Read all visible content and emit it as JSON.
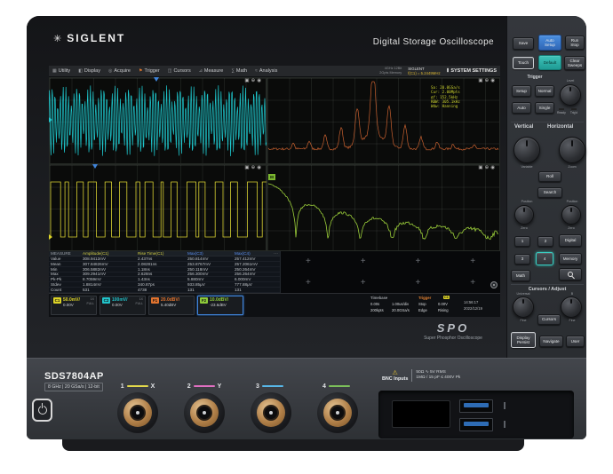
{
  "device": {
    "brand": "SIGLENT",
    "brand_icon": "✳",
    "screen_title": "Digital Storage Oscilloscope",
    "model": "SDS7804AP",
    "specs": "8 GHz | 20 GSa/s | 12-bit",
    "spo": "SPO",
    "spo_subtitle": "Super Phosphor Oscilloscope"
  },
  "menu": {
    "items": [
      {
        "label": "Utility",
        "icon": "▦"
      },
      {
        "label": "Display",
        "icon": "◧"
      },
      {
        "label": "Acquire",
        "icon": "◎"
      },
      {
        "label": "Trigger",
        "icon": "⚑"
      },
      {
        "label": "Cursors",
        "icon": "◫"
      },
      {
        "label": "Measure",
        "icon": "⊿"
      },
      {
        "label": "Math",
        "icon": "∑"
      },
      {
        "label": "Analysis",
        "icon": "≈"
      }
    ]
  },
  "status_strip": {
    "memory_line1": "4GHz 12Bit",
    "memory_line2": "2Gpts Memory",
    "brand": "SIGLENT",
    "counter": "f(C1) = 5.2449MHz",
    "settings_icon": "Ⅱ",
    "settings_label": "SYSTEM SETTINGS"
  },
  "quadrant_icons": {
    "snapshot": "▣",
    "crosshair": "⊕",
    "record": "◉"
  },
  "fft_readout": {
    "lines": [
      "Sa: 20.0GSa/s",
      "Cur: 2.00Mpts",
      "Δf: 152.5kHz",
      "RBW: 305.1kHz",
      "Wdw: Hanning"
    ]
  },
  "marker_m": "M",
  "plus_icon": "+",
  "measure_table": {
    "headers": [
      "MEASURE",
      "Amplitude(C1)",
      "Rise Time(C1)",
      "Max(C3)",
      "Max(C4)"
    ],
    "header_colors": [
      "#9aa0a8",
      "#d3cf45",
      "#d3cf45",
      "#5b8ff0",
      "#5b8ff0"
    ],
    "more_icon": "⋯",
    "rows": [
      {
        "name": "Value",
        "cells": [
          "308.9412mV",
          "2.437ns",
          "250.814mV",
          "257.412mV"
        ]
      },
      {
        "name": "Mean",
        "cells": [
          "307.84826mV",
          "2.08281ns",
          "253.8767mV",
          "257.2061mV"
        ]
      },
      {
        "name": "Min",
        "cells": [
          "306.5882mV",
          "1.18ns",
          "250.118mV",
          "250.264mV"
        ]
      },
      {
        "name": "Max",
        "cells": [
          "309.2941mV",
          "2.628ns",
          "256.300mV",
          "256.264mV"
        ]
      },
      {
        "name": "Pk-Pk",
        "cells": [
          "8.7059mV",
          "1.43ns",
          "5.880mV",
          "6.000mV"
        ]
      },
      {
        "name": "Stdev",
        "cells": [
          "1.8814mV",
          "340.87ps",
          "933.85μV",
          "777.88μV"
        ]
      },
      {
        "name": "Count",
        "cells": [
          "531",
          "4738",
          "131",
          "131"
        ]
      }
    ]
  },
  "status_bar": {
    "channels": [
      {
        "id": "C1",
        "color": "#ddd428",
        "probe": "1X",
        "coupling": "FULL",
        "scale": "50.0mV/",
        "offset": "0.00V",
        "selected": false
      },
      {
        "id": "C2",
        "color": "#22c3ca",
        "probe": "1X",
        "coupling": "FULL",
        "scale": "100mV/",
        "offset": "0.00V",
        "selected": false
      },
      {
        "id": "F1",
        "color": "#e0732f",
        "probe": "",
        "coupling": "",
        "scale": "20.0dBV/",
        "offset": "5.40dBV",
        "selected": false
      },
      {
        "id": "F2",
        "color": "#8ecb3a",
        "probe": "",
        "coupling": "",
        "scale": "10.0dBV/",
        "offset": "-23.6dBV",
        "selected": true
      }
    ],
    "timebase": {
      "label": "Timebase",
      "delay": "0.00s",
      "scale": "1.00us/div",
      "points": "200kpts",
      "rate": "20.0GSa/s"
    },
    "trigger": {
      "label": "Trigger",
      "source": "C1",
      "status": "Stop",
      "level": "0.00V",
      "type": "Edge",
      "slope": "Rising"
    },
    "clock": {
      "time": "14:56:17",
      "date": "2022/12/19"
    }
  },
  "control_panel": {
    "save": "Save",
    "auto_setup": "Auto Setup",
    "run_stop": "Run Stop",
    "touch": "Touch",
    "default": "Default",
    "clear_sweeps": "Clear Sweeps",
    "trigger_section": "Trigger",
    "setup": "Setup",
    "normal": "Normal",
    "auto": "Auto",
    "single": "Single",
    "level": "Level",
    "ready": "Ready",
    "trigd": "Trig'd",
    "vertical": "Vertical",
    "horizontal": "Horizontal",
    "variable": "Variable",
    "zoom": "Zoom",
    "roll": "Roll",
    "search": "Search",
    "position": "Position",
    "zero": "Zero",
    "ch1": "1",
    "ch2": "2",
    "ch3": "3",
    "ch4": "4",
    "digital": "Digital",
    "memory": "Memory",
    "math": "Math",
    "cursors_adjust": "Cursors / Adjust",
    "universal": "Universal",
    "knob_b": "B",
    "fine": "Fine",
    "cursors": "Cursors",
    "display_persist": "Display Persist",
    "navigate": "Navigate",
    "user": "User"
  },
  "front_panel": {
    "channels": [
      {
        "num": "1",
        "axis": "X",
        "color": "#e3d94b"
      },
      {
        "num": "2",
        "axis": "Y",
        "color": "#e06fc1"
      },
      {
        "num": "3",
        "axis": "",
        "color": "#58b7e8"
      },
      {
        "num": "4",
        "axis": "",
        "color": "#7cc05a"
      }
    ],
    "warning_icon": "⚠",
    "warning_title": "BNC Inputs",
    "warning_line1": "50Ω ∿ 5V RMS",
    "warning_line2": "1MΩ / 15 pF ≤ 400V Pk"
  }
}
